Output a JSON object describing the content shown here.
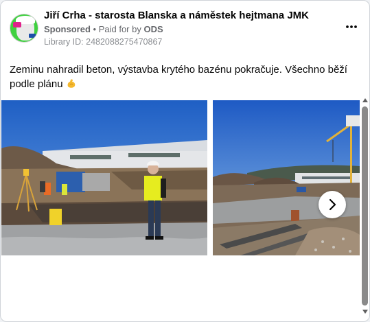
{
  "post": {
    "page_name": "Jiří Crha - starosta Blanska a náměstek hejtmana JMK",
    "sponsored": "Sponsored",
    "paid_for_prefix": "Paid for by",
    "paid_for_by": "ODS",
    "library_id": "Library ID: 2482088275470867",
    "text": "Zeminu nahradil beton, výstavba krytého bazénu pokračuje. Všechno běží podle plánu",
    "emoji": "flexed-biceps-icon"
  },
  "carousel": {
    "images": [
      "construction-site-worker-photo",
      "construction-site-crane-photo"
    ]
  },
  "colors": {
    "text": "#050505",
    "meta": "#65676b",
    "library": "#8a8d91",
    "avatar_bg": "#3fd13f"
  }
}
